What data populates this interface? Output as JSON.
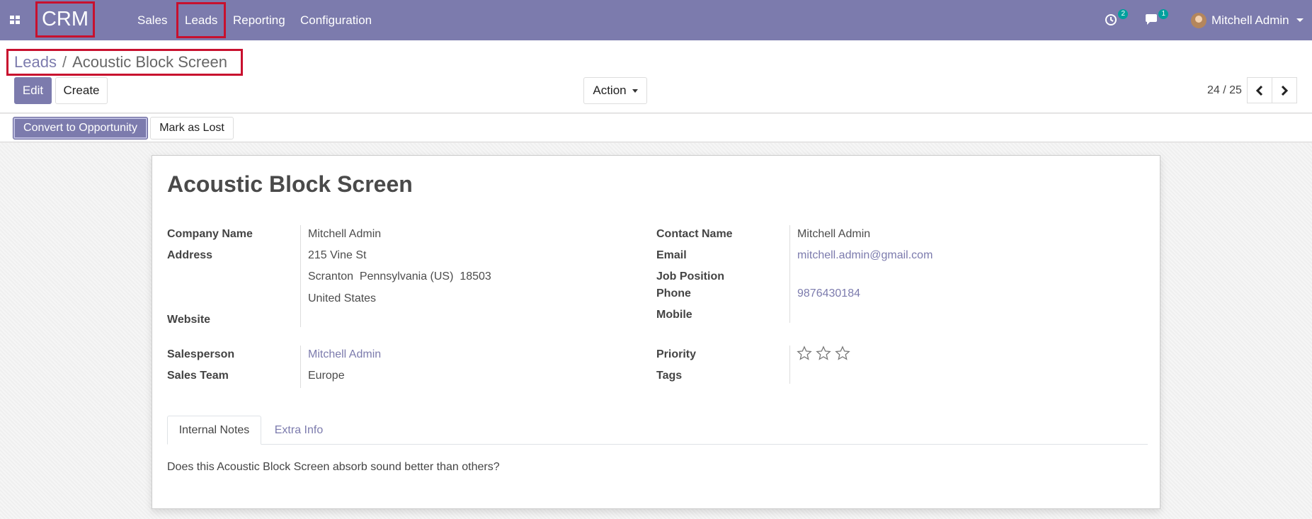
{
  "navbar": {
    "app_name": "CRM",
    "menu": [
      "Sales",
      "Leads",
      "Reporting",
      "Configuration"
    ],
    "activity_count": "2",
    "message_count": "1",
    "user_name": "Mitchell Admin"
  },
  "control_panel": {
    "breadcrumb": {
      "parent": "Leads",
      "separator": "/",
      "current": "Acoustic Block Screen"
    },
    "edit_label": "Edit",
    "create_label": "Create",
    "action_label": "Action",
    "pager": "24 / 25"
  },
  "statusbar": {
    "convert_label": "Convert to Opportunity",
    "lost_label": "Mark as Lost"
  },
  "record": {
    "title": "Acoustic Block Screen",
    "left": {
      "company_name_label": "Company Name",
      "company_name": "Mitchell Admin",
      "address_label": "Address",
      "street": "215 Vine St",
      "city_line": "Scranton  Pennsylvania (US)  18503",
      "country": "United States",
      "website_label": "Website",
      "salesperson_label": "Salesperson",
      "salesperson": "Mitchell Admin",
      "sales_team_label": "Sales Team",
      "sales_team": "Europe"
    },
    "right": {
      "contact_name_label": "Contact Name",
      "contact_name": "Mitchell Admin",
      "email_label": "Email",
      "email": "mitchell.admin@gmail.com",
      "job_position_label": "Job Position",
      "phone_label": "Phone",
      "phone": "9876430184",
      "mobile_label": "Mobile",
      "priority_label": "Priority",
      "priority_stars": 0,
      "tags_label": "Tags"
    },
    "tabs": [
      "Internal Notes",
      "Extra Info"
    ],
    "notes": "Does this Acoustic Block Screen absorb sound better than others?"
  },
  "colors": {
    "brand": "#7c7bad",
    "highlight_border": "#c8102e",
    "badge": "#00a09d"
  }
}
